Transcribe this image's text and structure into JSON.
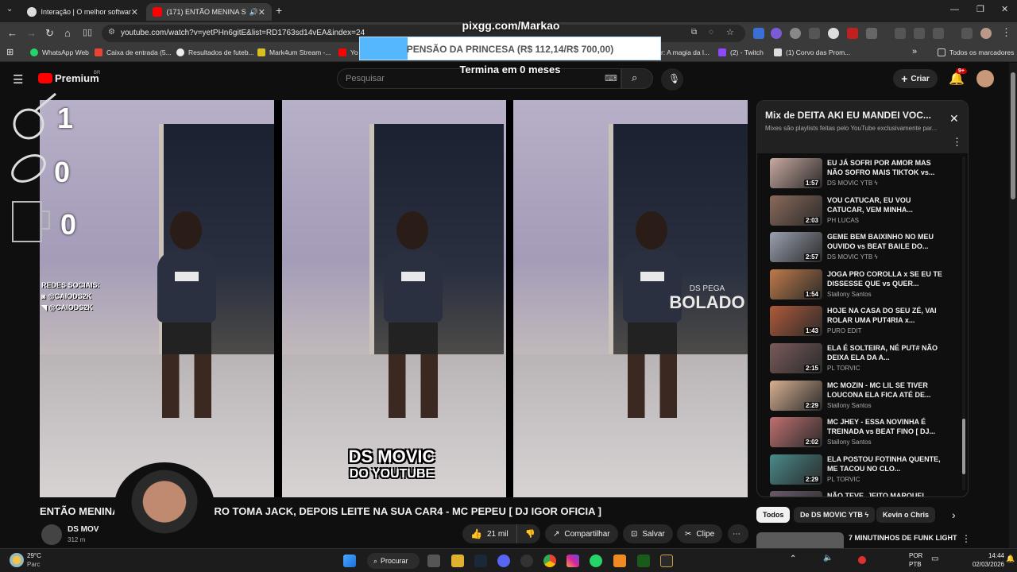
{
  "browser": {
    "tabs": [
      {
        "label": "Interação | O melhor software p",
        "active": false
      },
      {
        "label": "(171) ENTÃO MENINA SE P",
        "active": true
      }
    ],
    "new_tab": "+",
    "url": "youtube.com/watch?v=yetPHn6gitE&list=RD1763sd14vEA&index=24",
    "bookmarks": [
      "WhatsApp Web",
      "Caixa de entrada (5...",
      "Resultados de futeb...",
      "Mark4um Stream -...",
      "Yo",
      "r: A magia da l...",
      "(2) - Twitch",
      "(1) Corvo das Prom..."
    ],
    "all_bookmarks": "Todos os marcadores"
  },
  "overlay": {
    "pix": "pixgg.com/Markao",
    "goal_text": "PENSÃO DA PRINCESA (R$ 112,14/R$ 700,00)",
    "goal_progress": 0.16,
    "ends": "Termina em 0 meses",
    "counters": [
      "1",
      "0",
      "0"
    ],
    "social_title": "REDES SOCIAIS:",
    "social_handles": [
      "@CAIODS2K",
      "@CAIODS2K"
    ]
  },
  "youtube": {
    "logo": "Premium",
    "logo_sup": "BR",
    "search_placeholder": "Pesquisar",
    "create_label": "Criar",
    "notif_badge": "9+",
    "video_watermark_1": "DS MOVIC",
    "video_watermark_2": "DO YOUTUBE",
    "video_watermark_3": "DS PEGA",
    "video_watermark_4": "BOLADO",
    "video_title_left": "ENTÃO MENINA",
    "video_title_right": "EIRO TOMA JACK, DEPOIS LEITE NA SUA CAR4 - MC PEPEU [ DJ IGOR OFICIA ]",
    "channel_name": "DS MOV",
    "subscribers": "312 m",
    "likes": "21 mil",
    "share_label": "Compartilhar",
    "save_label": "Salvar",
    "clip_label": "Clipe",
    "mix_title": "Mix de DEITA AKI EU MANDEI VOC...",
    "mix_subtitle": "Mixes são playlists feitas pelo YouTube exclusivamente par...",
    "playlist": [
      {
        "title": "EU JÁ SOFRI POR AMOR MAS NÃO SOFRO MAIS TIKTOK vs...",
        "channel": "DS MOVIC YTB ϟ",
        "duration": "1:57",
        "color": "#c9a9a0"
      },
      {
        "title": "VOU CATUCAR, EU VOU CATUCAR, VEM MINHA...",
        "channel": "PH LUCAS",
        "duration": "2:03",
        "color": "#8a6a5a"
      },
      {
        "title": "GEME BEM BAIXINHO NO MEU OUVIDO vs BEAT BAILE DO...",
        "channel": "DS MOVIC YTB ϟ",
        "duration": "2:57",
        "color": "#9aa0b0"
      },
      {
        "title": "JOGA PRO COROLLA x SE EU TE DISSESSE QUE vs QUER...",
        "channel": "Stallony Santos",
        "duration": "1:54",
        "color": "#c07a4a"
      },
      {
        "title": "HOJE NA CASA DO SEU ZÉ, VAI ROLAR UMA PUT4RIA x...",
        "channel": "PURO EDIT",
        "duration": "1:43",
        "color": "#b05a3a"
      },
      {
        "title": "ELA É SOLTEIRA, NÉ PUT# NÃO DEIXA ELA DA A...",
        "channel": "PL TORVIC",
        "duration": "2:15",
        "color": "#7a5a5a"
      },
      {
        "title": "MC MOZIN - MC LIL SE TIVER LOUCONA ELA FICA ATÉ DE...",
        "channel": "Stallony Santos",
        "duration": "2:29",
        "color": "#d8b090"
      },
      {
        "title": "MC JHEY - ESSA NOVINHA É TREINADA vs BEAT FINO [ DJ...",
        "channel": "Stallony Santos",
        "duration": "2:02",
        "color": "#c07070"
      },
      {
        "title": "ELA POSTOU FOTINHA QUENTE, ME TACOU NO CLO...",
        "channel": "PL TORVIC",
        "duration": "2:29",
        "color": "#4a8a8a"
      },
      {
        "title": "NÃO TEVE, JEITO MARQUEI",
        "channel": "",
        "duration": "",
        "color": "#6a5a6a"
      }
    ],
    "chips": [
      "Todos",
      "De DS MOVIC YTB ϟ",
      "Kevin o Chris"
    ],
    "rec_title": "7 MINUTINHOS DE FUNK LIGHT"
  },
  "taskbar": {
    "weather_temp": "29°C",
    "weather_desc": "Parc",
    "search_label": "Procurar",
    "lang_1": "POR",
    "lang_2": "PTB",
    "time": "14:44",
    "date": "02/03/2026"
  }
}
